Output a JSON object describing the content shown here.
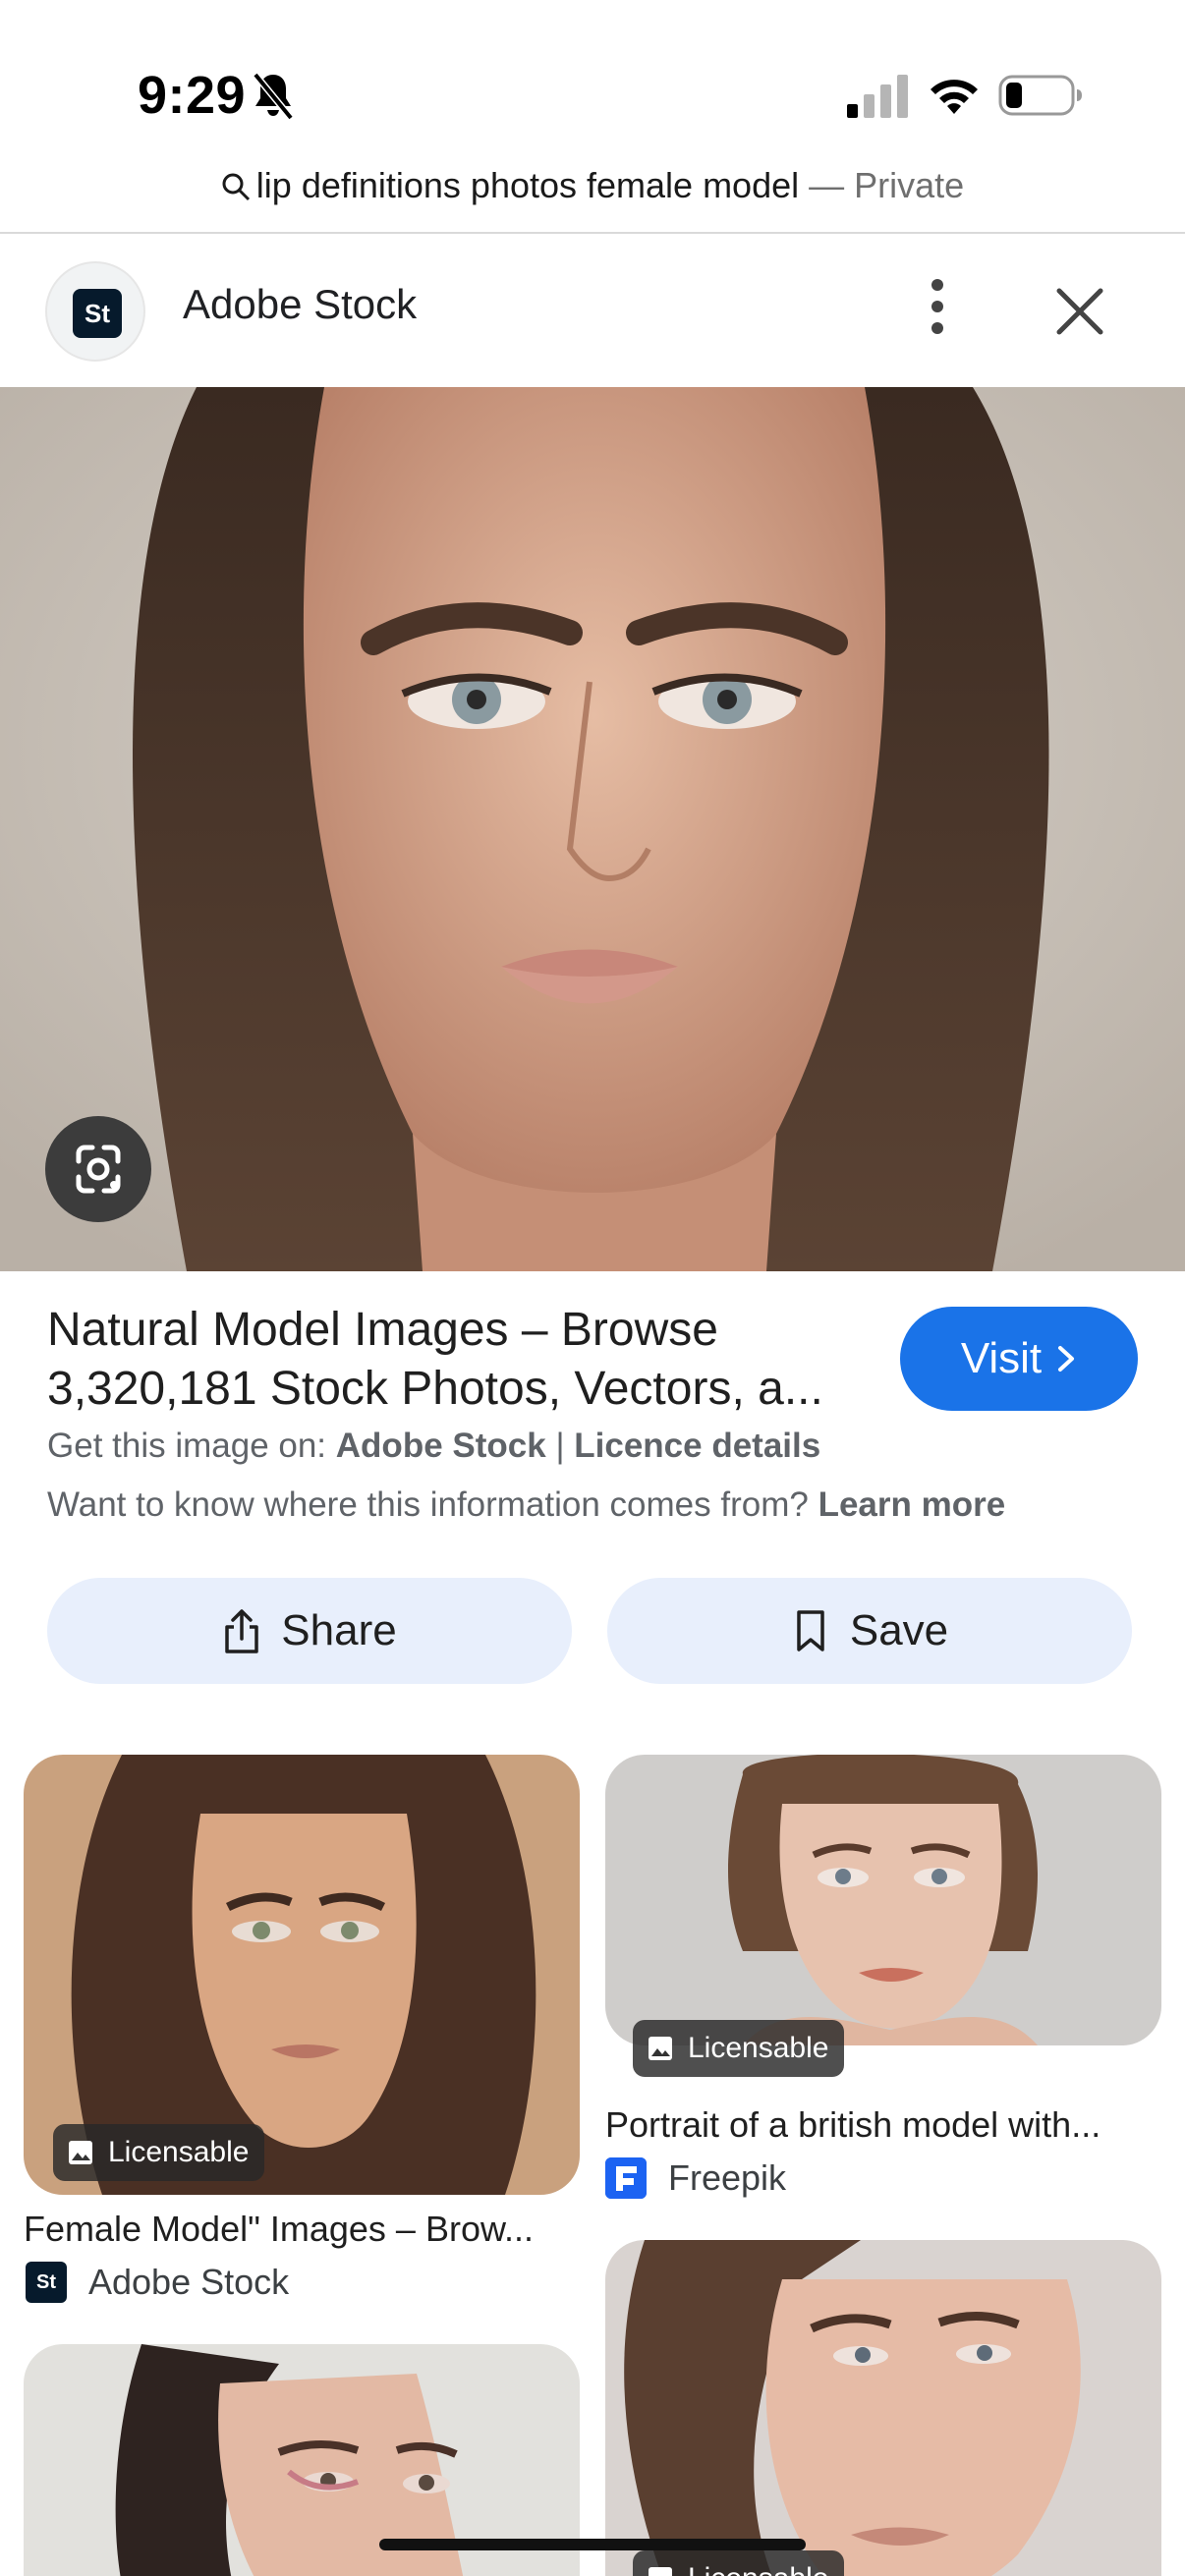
{
  "status_bar": {
    "time": "9:29"
  },
  "browser": {
    "query": "lip definitions photos female model",
    "mode_label": "— Private"
  },
  "source_header": {
    "logo_text": "St",
    "title": "Adobe Stock"
  },
  "result": {
    "title": "Natural Model Images – Browse 3,320,181 Stock Photos, Vectors, a...",
    "visit_label": "Visit",
    "get_image_prefix": "Get this image on:",
    "get_image_source": "Adobe Stock",
    "separator": "|",
    "licence_link": "Licence details",
    "where_text": "Want to know where this information comes from?",
    "learn_more": "Learn more"
  },
  "actions": {
    "share_label": "Share",
    "save_label": "Save"
  },
  "grid": [
    {
      "title": "Female Model\" Images – Brow...",
      "source": "Adobe Stock",
      "source_logo": "St",
      "badge": "Licensable"
    },
    {
      "title": "Portrait of a british model with...",
      "source": "Freepik",
      "source_logo": "F",
      "badge": "Licensable"
    },
    {
      "title": "",
      "source": "",
      "source_logo": "",
      "badge": ""
    },
    {
      "title": "",
      "source": "",
      "source_logo": "",
      "badge": "Licensable"
    }
  ],
  "colors": {
    "accent": "#1a73e8",
    "chip_bg": "#e8effc",
    "adobe_logo": "#061a2c",
    "freepik_logo": "#1c63f2"
  },
  "icons": [
    "bell-slash-icon",
    "cellular-icon",
    "wifi-icon",
    "battery-icon",
    "search-icon",
    "more-vert-icon",
    "close-icon",
    "google-lens-icon",
    "chevron-right-icon",
    "share-icon",
    "bookmark-icon",
    "image-icon"
  ]
}
